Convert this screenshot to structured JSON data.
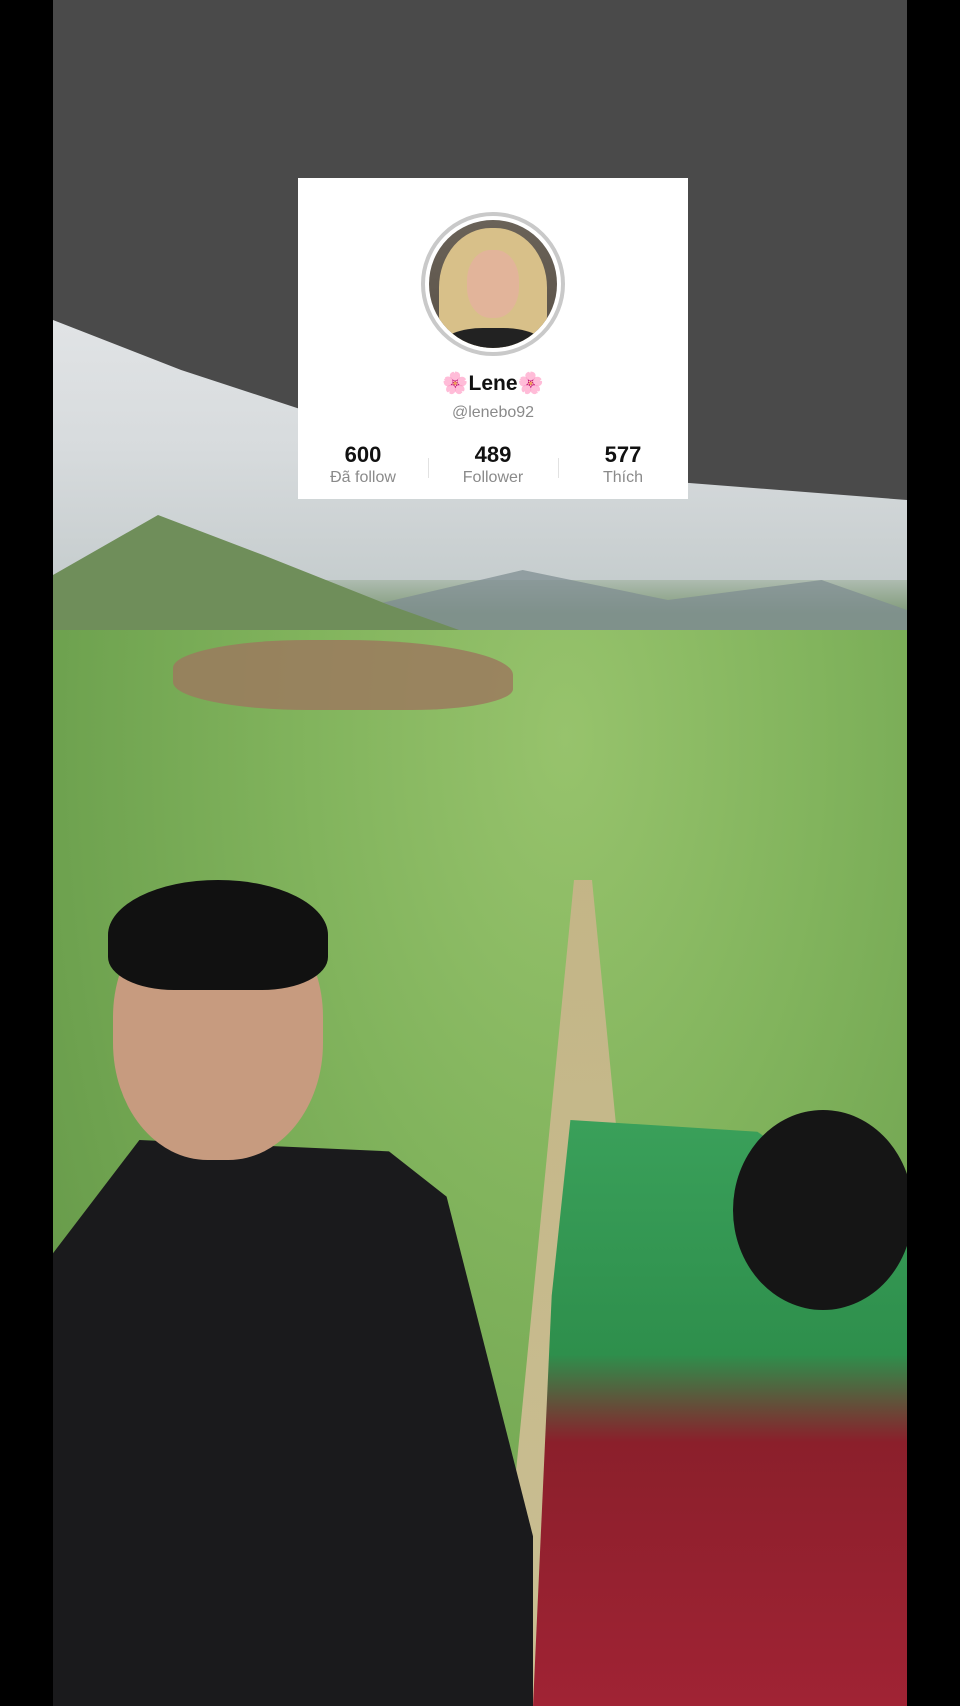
{
  "profile": {
    "name": "🌸Lene🌸",
    "handle": "@lenebo92",
    "stats": [
      {
        "value": "600",
        "label": "Đã follow"
      },
      {
        "value": "489",
        "label": "Follower"
      },
      {
        "value": "577",
        "label": "Thích"
      }
    ]
  }
}
